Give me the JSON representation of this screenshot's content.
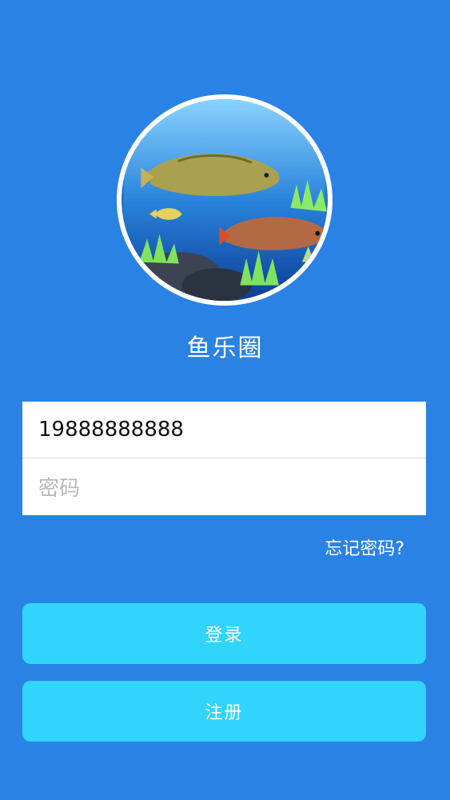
{
  "app": {
    "name": "鱼乐圈"
  },
  "form": {
    "username_value": "19888888888",
    "password_placeholder": "密码"
  },
  "links": {
    "forgot_password": "忘记密码?"
  },
  "buttons": {
    "login": "登录",
    "register": "注册"
  }
}
